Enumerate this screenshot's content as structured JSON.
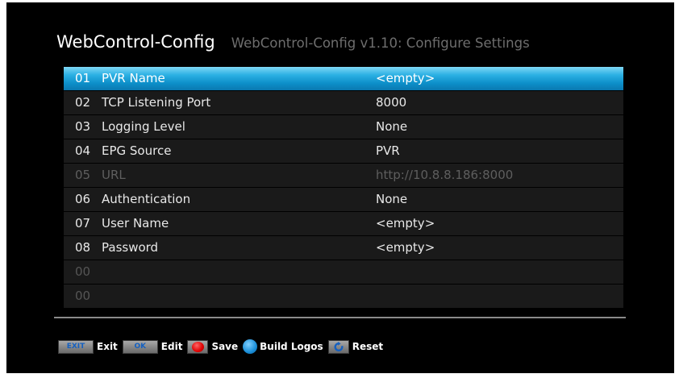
{
  "header": {
    "title": "WebControl-Config",
    "subtitle": "WebControl-Config v1.10: Configure Settings"
  },
  "settings": [
    {
      "num": "01",
      "name": "PVR Name",
      "value": "<empty>",
      "state": "selected"
    },
    {
      "num": "02",
      "name": "TCP Listening Port",
      "value": "8000",
      "state": "normal"
    },
    {
      "num": "03",
      "name": "Logging Level",
      "value": "None",
      "state": "normal"
    },
    {
      "num": "04",
      "name": "EPG Source",
      "value": "PVR",
      "state": "normal"
    },
    {
      "num": "05",
      "name": "URL",
      "value": "http://10.8.8.186:8000",
      "state": "disabled"
    },
    {
      "num": "06",
      "name": "Authentication",
      "value": "None",
      "state": "normal"
    },
    {
      "num": "07",
      "name": "User Name",
      "value": "<empty>",
      "state": "normal"
    },
    {
      "num": "08",
      "name": "Password",
      "value": "<empty>",
      "state": "normal"
    },
    {
      "num": "00",
      "name": "",
      "value": "",
      "state": "empty"
    },
    {
      "num": "00",
      "name": "",
      "value": "",
      "state": "empty"
    }
  ],
  "footer": {
    "exit_key": "EXIT",
    "exit_label": "Exit",
    "ok_key": "OK",
    "edit_label": "Edit",
    "save_label": "Save",
    "build_logos_label": "Build Logos",
    "reset_label": "Reset"
  },
  "colors": {
    "selected_row": "#1aa3dc",
    "row_bg": "#1a1a1a",
    "screen_bg": "#000000",
    "save_button": "#e00000",
    "build_logos_button": "#1a8ed8"
  }
}
